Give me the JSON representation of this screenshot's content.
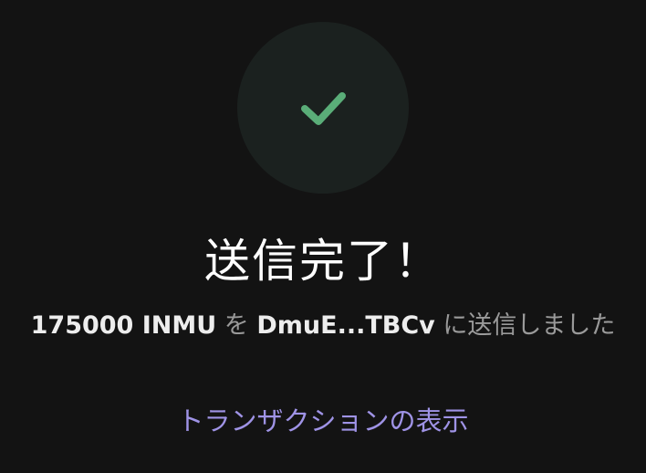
{
  "status": {
    "icon": "checkmark-icon",
    "title": "送信完了！"
  },
  "message": {
    "amount": "175000 INMU",
    "particle_object": "を",
    "recipient": "DmuE...TBCv",
    "suffix": "に送信しました"
  },
  "actions": {
    "view_transaction": "トランザクションの表示"
  },
  "colors": {
    "background": "#131313",
    "circle": "#1b211f",
    "check": "#5aad78",
    "title": "#ffffff",
    "message_bold": "#ededed",
    "message_muted": "#9a9a9a",
    "link": "#9f93e6"
  }
}
